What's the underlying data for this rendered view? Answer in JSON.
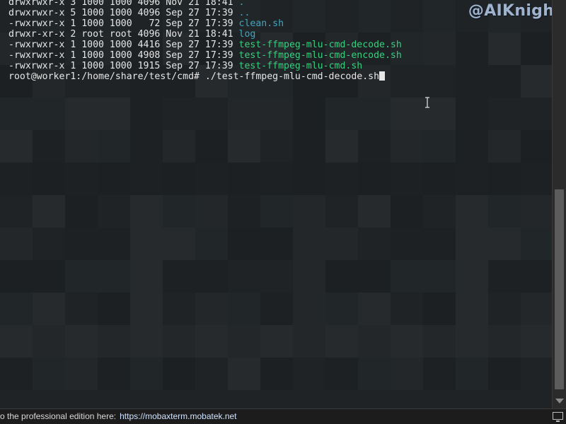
{
  "terminal": {
    "listing": [
      {
        "perms": "drwxrwxr-x",
        "links": "3",
        "owner": "1000",
        "group": "1000",
        "size": "4096",
        "date": "Nov 21 18:41",
        "name": ".",
        "kind": "dir"
      },
      {
        "perms": "drwxrwxr-x",
        "links": "5",
        "owner": "1000",
        "group": "1000",
        "size": "4096",
        "date": "Sep 27 17:39",
        "name": "..",
        "kind": "dir"
      },
      {
        "perms": "-rwxrwxr-x",
        "links": "1",
        "owner": "1000",
        "group": "1000",
        "size": "72",
        "date": "Sep 27 17:39",
        "name": "clean.sh",
        "kind": "dir"
      },
      {
        "perms": "drwxr-xr-x",
        "links": "2",
        "owner": "root",
        "group": "root",
        "size": "4096",
        "date": "Nov 21 18:41",
        "name": "log",
        "kind": "dir"
      },
      {
        "perms": "-rwxrwxr-x",
        "links": "1",
        "owner": "1000",
        "group": "1000",
        "size": "4416",
        "date": "Sep 27 17:39",
        "name": "test-ffmpeg-mlu-cmd-decode.sh",
        "kind": "exe"
      },
      {
        "perms": "-rwxrwxr-x",
        "links": "1",
        "owner": "1000",
        "group": "1000",
        "size": "4908",
        "date": "Sep 27 17:39",
        "name": "test-ffmpeg-mlu-cmd-encode.sh",
        "kind": "exe"
      },
      {
        "perms": "-rwxrwxr-x",
        "links": "1",
        "owner": "1000",
        "group": "1000",
        "size": "1915",
        "date": "Sep 27 17:39",
        "name": "test-ffmpeg-mlu-cmd.sh",
        "kind": "exe"
      }
    ],
    "prompt": "root@worker1:/home/share/test/cmd# ",
    "command": "./test-ffmpeg-mlu-cmd-decode.sh"
  },
  "watermark": "@AIKnight",
  "statusbar": {
    "text": "o the professional edition here:",
    "link": "https://mobaxterm.mobatek.net"
  },
  "colors": {
    "background": "#1f2326",
    "text": "#e6e6e6",
    "directory": "#3aa8c4",
    "executable": "#36d07e"
  },
  "icons": {
    "cursor": "text-cursor-icon",
    "status": "monitor-icon"
  }
}
